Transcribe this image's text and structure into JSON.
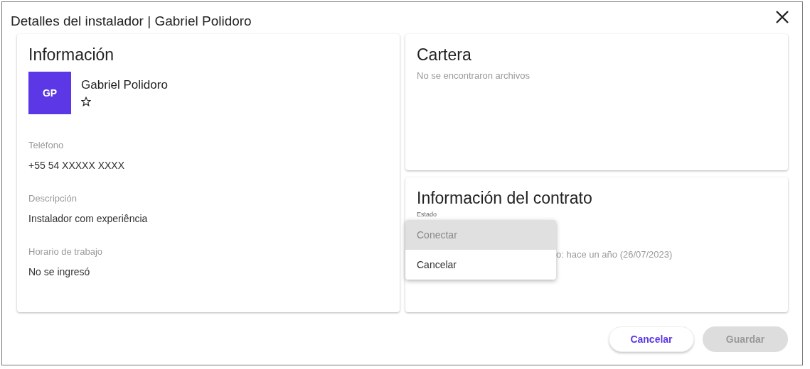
{
  "dialog": {
    "title": "Detalles del instalador | Gabriel Polidoro"
  },
  "info": {
    "heading": "Información",
    "avatar_initials": "GP",
    "name": "Gabriel Polidoro",
    "favorite": false,
    "fields": [
      {
        "label": "Teléfono",
        "value": "+55 54 XXXXX XXXX"
      },
      {
        "label": "Descripción",
        "value": "Instalador com experiência"
      },
      {
        "label": "Horario de trabajo",
        "value": "No se ingresó"
      }
    ]
  },
  "wallet": {
    "heading": "Cartera",
    "empty_text": "No se encontraron archivos"
  },
  "contract": {
    "heading": "Información del contrato",
    "status_label": "Estado",
    "date_text": "o: hace un año (26/07/2023)"
  },
  "status_menu": [
    {
      "label": "Conectar",
      "selected": true
    },
    {
      "label": "Cancelar",
      "selected": false
    }
  ],
  "buttons": [
    {
      "label": "Cancelar",
      "kind": "secondary",
      "disabled": false
    },
    {
      "label": "Guardar",
      "kind": "primary",
      "disabled": true
    }
  ]
}
